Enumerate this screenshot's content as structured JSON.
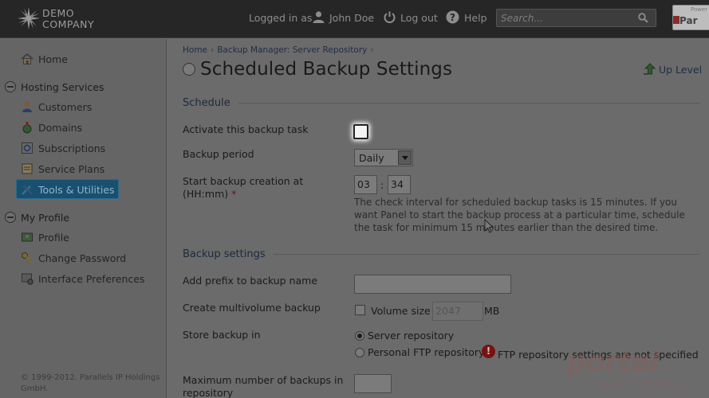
{
  "header": {
    "logo": {
      "line1": "DEMO",
      "line2": "COMPANY"
    },
    "logged_in_as": "Logged in as",
    "user_name": "John Doe",
    "logout": "Log out",
    "help": "Help",
    "search_placeholder": "Search...",
    "brand_powered": "Power",
    "brand_name": "Par"
  },
  "sidebar": {
    "home": "Home",
    "hosting_services": "Hosting Services",
    "customers": "Customers",
    "domains": "Domains",
    "subscriptions": "Subscriptions",
    "service_plans": "Service Plans",
    "tools_utilities": "Tools & Utilities",
    "my_profile": "My Profile",
    "profile": "Profile",
    "change_password": "Change Password",
    "interface_preferences": "Interface Preferences",
    "copyright_line1": "© 1999-2012. Parallels IP Holdings",
    "copyright_line2": "GmbH."
  },
  "main": {
    "breadcrumb": [
      "Home",
      "Backup Manager: Server Repository"
    ],
    "title": "Scheduled Backup Settings",
    "up_level": "Up Level",
    "schedule": {
      "heading": "Schedule",
      "activate_label": "Activate this backup task",
      "activate_checked": false,
      "period_label": "Backup period",
      "period_value": "Daily",
      "start_label_line1": "Start backup creation at",
      "start_label_line2": "(HH:mm)",
      "required_mark": "*",
      "hour": "03",
      "minute": "34",
      "help_line1": "The check interval for scheduled backup tasks is 15 minutes. If you",
      "help_line2": "want Panel to start the backup process at a particular time, schedule",
      "help_line3": "the task for minimum 15 minutes earlier than the desired time."
    },
    "backup_settings": {
      "heading": "Backup settings",
      "prefix_label": "Add prefix to backup name",
      "prefix_value": "",
      "multivolume_label": "Create multivolume backup",
      "volume_size_label": "Volume size",
      "volume_size_value": "2047",
      "volume_unit": "MB",
      "store_label": "Store backup in",
      "store_option_server": "Server repository",
      "store_option_ftp": "Personal FTP repository",
      "ftp_warning": "FTP repository settings are not specified",
      "max_backups_label_line1": "Maximum number of backups in",
      "max_backups_label_line2": "repository",
      "max_backups_value": ""
    }
  },
  "watermark": {
    "main": "portal",
    "sub": "web hosting"
  }
}
